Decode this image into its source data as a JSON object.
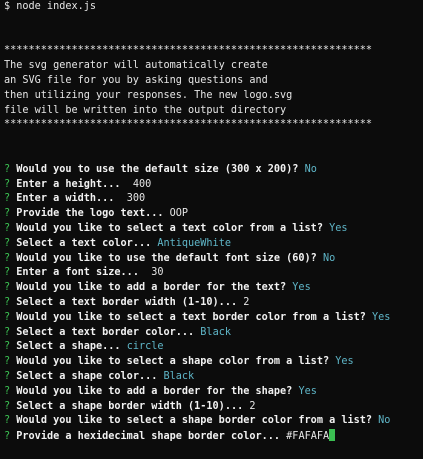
{
  "command": "$ node index.js",
  "banner": [
    "************************************************************",
    "The svg generator will automatically create",
    "an SVG file for you by asking questions and",
    "then utilizing your responses. The new logo.svg",
    "file will be written into the output directory",
    "************************************************************"
  ],
  "prompt_symbol": "?",
  "prompts": [
    {
      "q": "Would you to use the default size (300 x 200)?",
      "a": "No",
      "style": "ans"
    },
    {
      "q": "Enter a height...",
      "a": "400",
      "style": "plain"
    },
    {
      "q": "Enter a width...",
      "a": "300",
      "style": "plain"
    },
    {
      "q": "Provide the logo text...",
      "a": "OOP",
      "style": "plain"
    },
    {
      "q": "Would you like to select a text color from a list?",
      "a": "Yes",
      "style": "ans"
    },
    {
      "q": "Select a text color...",
      "a": "AntiqueWhite",
      "style": "ans"
    },
    {
      "q": "Would you like to use the default font size (60)?",
      "a": "No",
      "style": "ans"
    },
    {
      "q": "Enter a font size...",
      "a": "30",
      "style": "plain"
    },
    {
      "q": "Would you like to add a border for the text?",
      "a": "Yes",
      "style": "ans"
    },
    {
      "q": "Select a text border width (1-10)...",
      "a": "2",
      "style": "plain"
    },
    {
      "q": "Would you like to select a text border color from a list?",
      "a": "Yes",
      "style": "ans"
    },
    {
      "q": "Select a text border color...",
      "a": "Black",
      "style": "ans"
    },
    {
      "q": "Select a shape...",
      "a": "circle",
      "style": "ans"
    },
    {
      "q": "Would you like to select a shape color from a list?",
      "a": "Yes",
      "style": "ans"
    },
    {
      "q": "Select a shape color...",
      "a": "Black",
      "style": "ans"
    },
    {
      "q": "Would you like to add a border for the shape?",
      "a": "Yes",
      "style": "ans"
    },
    {
      "q": "Select a shape border width (1-10)...",
      "a": "2",
      "style": "plain"
    },
    {
      "q": "Would you like to select a shape border color from a list?",
      "a": "No",
      "style": "ans"
    },
    {
      "q": "Provide a hexidecimal shape border color...",
      "a": "#FAFAFA",
      "style": "plain",
      "cursor": true
    }
  ],
  "colors": {
    "background": "#0c0c0c",
    "prompt_symbol": "#3bbf52",
    "answer": "#5fb6c8",
    "text": "#e6e6e6"
  }
}
